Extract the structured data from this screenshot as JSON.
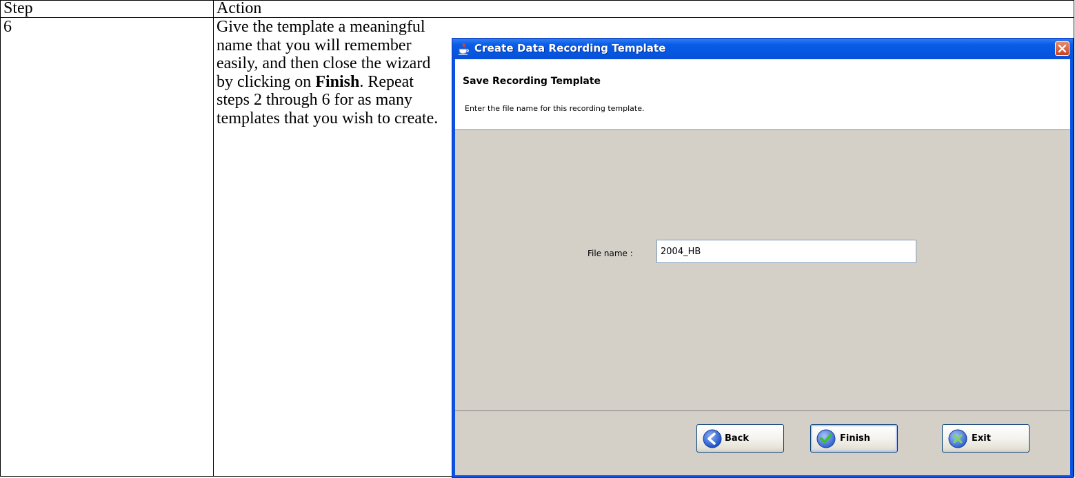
{
  "table": {
    "header_step": "Step",
    "header_action": "Action",
    "row_step": "6",
    "instruction": {
      "part1": "Give the template a meaningful name that you will remember easily, and then close the wizard by clicking on ",
      "bold": "Finish",
      "part2": ".  Repeat steps 2 through 6 for as many templates that you wish to create."
    }
  },
  "dialog": {
    "title": "Create Data Recording Template",
    "header_title": "Save Recording Template",
    "header_description": "Enter the file name for this recording template.",
    "file_name_label": "File name :",
    "file_name_value": "2004_HB",
    "buttons": {
      "back": "Back",
      "finish": "Finish",
      "exit": "Exit"
    },
    "icons": {
      "app": "java-cup-icon",
      "close": "close-icon",
      "back": "back-arrow-icon",
      "finish": "checkmark-icon",
      "exit": "exit-x-icon"
    },
    "colors": {
      "titlebar": "#0a5be6",
      "close": "#d4502b",
      "panel": "#d4d0c8"
    }
  }
}
